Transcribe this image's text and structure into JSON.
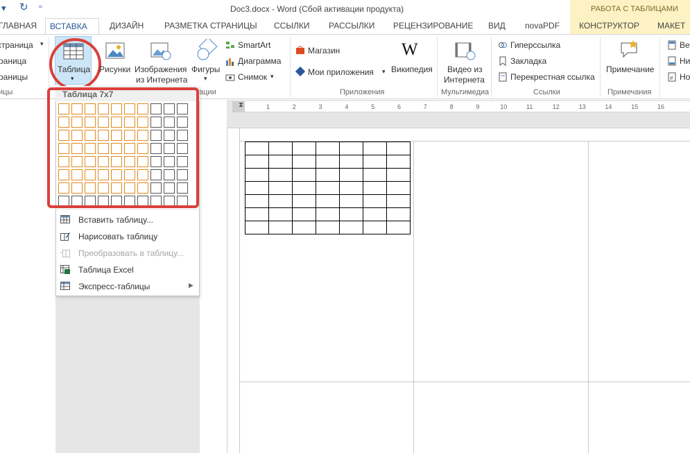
{
  "title_bar": {
    "document_title": "Doc3.docx - Word (Сбой активации продукта)",
    "contextual_header": "РАБОТА С ТАБЛИЦАМИ"
  },
  "tabs": [
    {
      "label": "ГЛАВНАЯ"
    },
    {
      "label": "ВСТАВКА"
    },
    {
      "label": "ДИЗАЙН"
    },
    {
      "label": "РАЗМЕТКА СТРАНИЦЫ"
    },
    {
      "label": "ССЫЛКИ"
    },
    {
      "label": "РАССЫЛКИ"
    },
    {
      "label": "РЕЦЕНЗИРОВАНИЕ"
    },
    {
      "label": "ВИД"
    },
    {
      "label": "novaPDF"
    },
    {
      "label": "КОНСТРУКТОР"
    },
    {
      "label": "МАКЕТ"
    }
  ],
  "ribbon": {
    "pages": {
      "cover": "страница",
      "blank": "раница",
      "break": "раницы",
      "group": "ицы"
    },
    "tables": {
      "label": "Таблица"
    },
    "illustrations": {
      "pictures": "Рисунки",
      "online_pictures_1": "Изображения",
      "online_pictures_2": "из Интернета",
      "shapes": "Фигуры",
      "smartart": "SmartArt",
      "chart": "Диаграмма",
      "screenshot": "Снимок",
      "group": "ации"
    },
    "apps": {
      "store": "Магазин",
      "my_apps": "Мои приложения",
      "wikipedia": "Википедия",
      "group": "Приложения"
    },
    "media": {
      "video_1": "Видео из",
      "video_2": "Интернета",
      "group": "Мультимедиа"
    },
    "links": {
      "hyperlink": "Гиперссылка",
      "bookmark": "Закладка",
      "cross_ref": "Перекрестная ссылка",
      "group": "Ссылки"
    },
    "comments": {
      "comment": "Примечание",
      "group": "Примечания"
    },
    "header_footer": {
      "header": "Вер",
      "footer": "Ни",
      "page_number": "Но"
    }
  },
  "table_dropdown": {
    "header": "Таблица 7x7",
    "grid_cols": 10,
    "grid_rows": 8,
    "selected_cols": 7,
    "selected_rows": 7,
    "menu": [
      {
        "label": "Вставить таблицу...",
        "enabled": true,
        "icon": "insert-table-icon"
      },
      {
        "label": "Нарисовать таблицу",
        "enabled": true,
        "icon": "draw-table-icon"
      },
      {
        "label": "Преобразовать в таблицу...",
        "enabled": false,
        "icon": "convert-table-icon"
      },
      {
        "label": "Таблица Excel",
        "enabled": true,
        "icon": "excel-table-icon"
      },
      {
        "label": "Экспресс-таблицы",
        "enabled": true,
        "icon": "quick-tables-icon"
      }
    ]
  },
  "ruler": {
    "numbers": [
      "1",
      "2",
      "3",
      "4",
      "5",
      "6",
      "7",
      "8",
      "9",
      "10",
      "11",
      "12",
      "13",
      "14",
      "15",
      "16"
    ]
  },
  "document": {
    "table_rows": 7,
    "table_cols": 7
  },
  "colors": {
    "accent": "#2b579a",
    "highlight_red": "#d9403a",
    "grid_orange": "#e08a1e",
    "tools_bg": "#fdf2c3"
  }
}
